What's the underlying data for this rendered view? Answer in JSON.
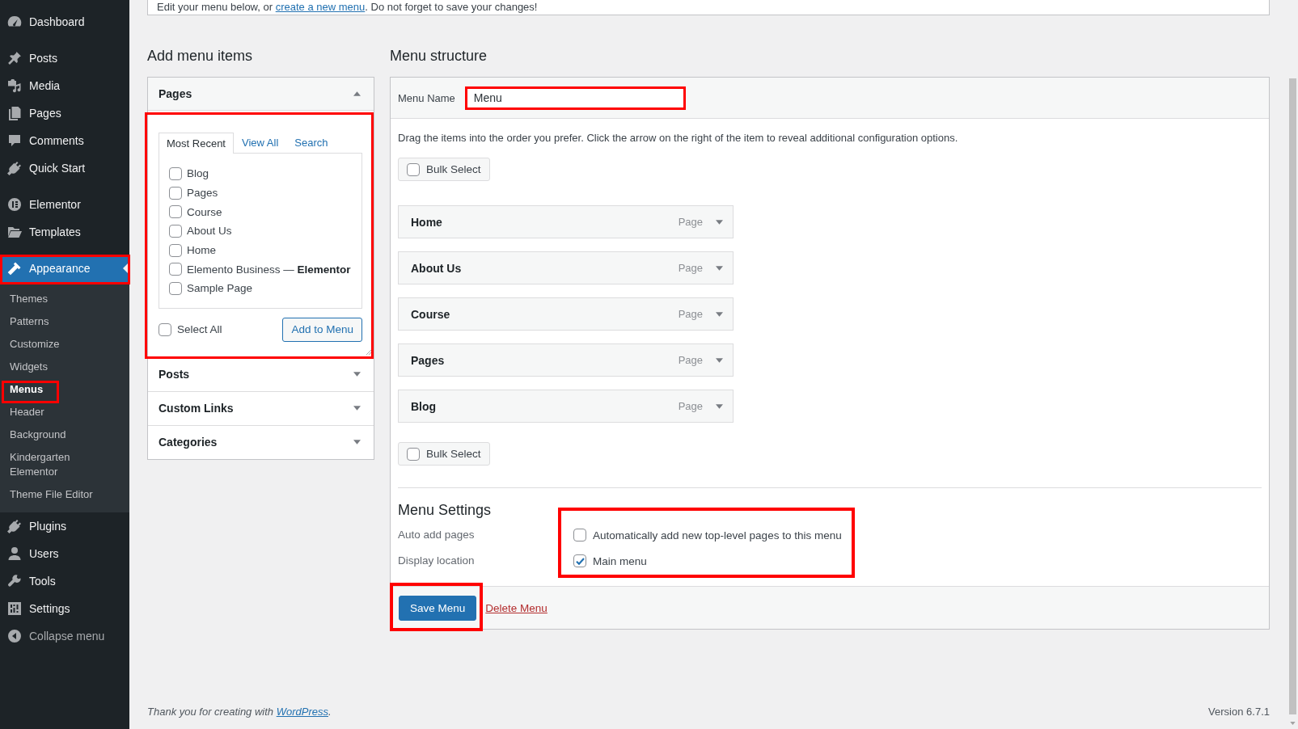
{
  "sidebar": {
    "groups": [
      {
        "items": [
          {
            "label": "Dashboard",
            "selected": false,
            "highlighted": false
          }
        ]
      },
      {
        "items": [
          {
            "label": "Posts",
            "selected": false,
            "highlighted": false
          },
          {
            "label": "Media",
            "selected": false,
            "highlighted": false
          },
          {
            "label": "Pages",
            "selected": false,
            "highlighted": false
          },
          {
            "label": "Comments",
            "selected": false,
            "highlighted": false
          },
          {
            "label": "Quick Start",
            "selected": false,
            "highlighted": false
          }
        ]
      },
      {
        "items": [
          {
            "label": "Elementor",
            "selected": false,
            "highlighted": false
          },
          {
            "label": "Templates",
            "selected": false,
            "highlighted": false
          }
        ]
      },
      {
        "items": [
          {
            "label": "Appearance",
            "selected": true,
            "highlighted": true,
            "submenu": [
              {
                "label": "Themes",
                "selected": false,
                "highlighted": false
              },
              {
                "label": "Patterns",
                "selected": false,
                "highlighted": false
              },
              {
                "label": "Customize",
                "selected": false,
                "highlighted": false
              },
              {
                "label": "Widgets",
                "selected": false,
                "highlighted": false
              },
              {
                "label": "Menus",
                "selected": true,
                "highlighted": true
              },
              {
                "label": "Header",
                "selected": false,
                "highlighted": false
              },
              {
                "label": "Background",
                "selected": false,
                "highlighted": false
              },
              {
                "label": "Kindergarten Elementor",
                "selected": false,
                "highlighted": false
              },
              {
                "label": "Theme File Editor",
                "selected": false,
                "highlighted": false
              }
            ]
          },
          {
            "label": "Plugins",
            "selected": false,
            "highlighted": false
          },
          {
            "label": "Users",
            "selected": false,
            "highlighted": false
          },
          {
            "label": "Tools",
            "selected": false,
            "highlighted": false
          },
          {
            "label": "Settings",
            "selected": false,
            "highlighted": false
          }
        ]
      }
    ],
    "collapse": {
      "label": "Collapse menu"
    }
  },
  "notice": {
    "text_before": "Edit your menu below, or ",
    "link": "create a new menu",
    "text_after": ". Do not forget to save your changes!"
  },
  "add_menu_items": {
    "title": "Add menu items",
    "panels": [
      {
        "title": "Pages",
        "expanded": true,
        "highlighted": true,
        "tabs": [
          {
            "label": "Most Recent",
            "selected": true
          },
          {
            "label": "View All",
            "selected": false
          },
          {
            "label": "Search",
            "selected": false
          }
        ],
        "items": [
          {
            "label": "Blog",
            "checked": false
          },
          {
            "label": "Pages",
            "checked": false
          },
          {
            "label": "Course",
            "checked": false
          },
          {
            "label": "About Us",
            "checked": false
          },
          {
            "label": "Home",
            "checked": false
          },
          {
            "label": "Elemento Business — **Elementor**",
            "checked": false
          },
          {
            "label": "Sample Page",
            "checked": false
          }
        ],
        "select_all": {
          "label": "Select All",
          "checked": false
        },
        "add_button": "Add to Menu"
      },
      {
        "title": "Posts",
        "expanded": false,
        "highlighted": false
      },
      {
        "title": "Custom Links",
        "expanded": false,
        "highlighted": false
      },
      {
        "title": "Categories",
        "expanded": false,
        "highlighted": false
      }
    ]
  },
  "menu_structure": {
    "title": "Menu structure",
    "menu_name": {
      "label": "Menu Name",
      "value": "Menu",
      "highlighted": true
    },
    "instructions": "Drag the items into the order you prefer. Click the arrow on the right of the item to reveal additional configuration options.",
    "bulk_select_top": {
      "label": "Bulk Select",
      "checked": false
    },
    "items": [
      {
        "title": "Home",
        "type": "Page"
      },
      {
        "title": "About Us",
        "type": "Page"
      },
      {
        "title": "Course",
        "type": "Page"
      },
      {
        "title": "Pages",
        "type": "Page"
      },
      {
        "title": "Blog",
        "type": "Page"
      }
    ],
    "bulk_select_bottom": {
      "label": "Bulk Select",
      "checked": false
    },
    "settings": {
      "title": "Menu Settings",
      "highlighted": true,
      "rows": [
        {
          "label": "Auto add pages",
          "option": {
            "label": "Automatically add new top-level pages to this menu",
            "checked": false
          }
        },
        {
          "label": "Display location",
          "option": {
            "label": "Main menu",
            "checked": true
          }
        }
      ]
    },
    "save_button": {
      "label": "Save Menu",
      "highlighted": true
    },
    "delete_link": "Delete Menu"
  },
  "footer": {
    "text": "Thank you for creating with ",
    "link": "WordPress",
    "end": ".",
    "version": "Version 6.7.1"
  }
}
